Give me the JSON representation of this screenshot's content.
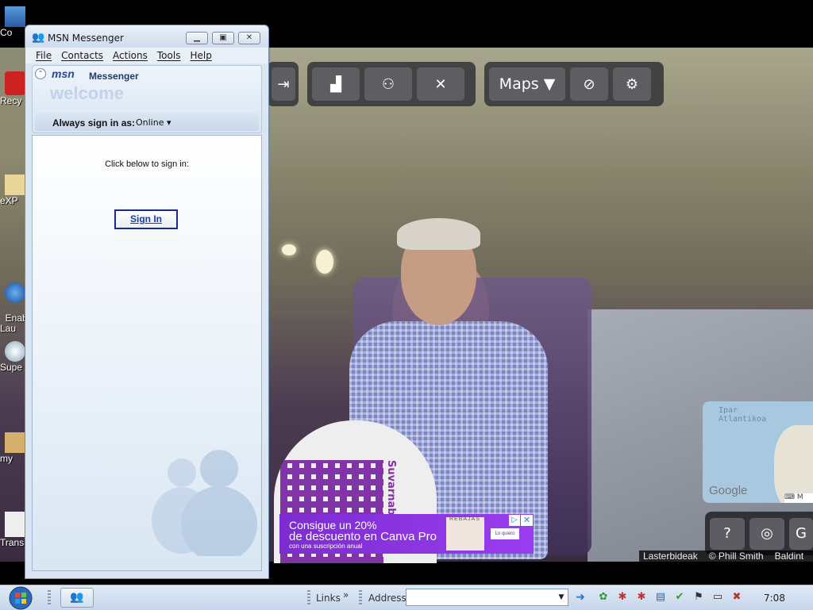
{
  "window": {
    "title": "MSN Messenger",
    "menu": [
      "File",
      "Contacts",
      "Actions",
      "Tools",
      "Help"
    ],
    "logo_text": "msn",
    "logo_word": "Messenger",
    "welcome": "welcome",
    "always_sign_in_label": "Always sign in as:",
    "status": "Online",
    "status_caret": "▾",
    "click_below": "Click below to sign in:",
    "sign_in_button": "Sign In"
  },
  "desktop_icons": [
    "Co",
    "Recy",
    "eXP",
    "Enab\nLau",
    "Supe",
    "my",
    "Trans"
  ],
  "streetview": {
    "maps_button": "Maps ▼",
    "map_ocean_label": "Ipar\nAtlantikoa",
    "google_logo": "Google",
    "help_button": "?",
    "credits": [
      "Lasterbideak",
      "© Phill Smith",
      "Baldint"
    ],
    "qr_text": "Suvarnab"
  },
  "ad": {
    "line1": "Consigue un 20%",
    "line2": "de descuento en Canva Pro",
    "line3": "con una suscripción anual",
    "brand": "REBAJAS",
    "cta": "Lo quiero"
  },
  "taskbar": {
    "links_label": "Links",
    "links_chevron": "»",
    "address_label": "Address",
    "address_value": "",
    "clock": "7:08"
  },
  "colors": {
    "msn_frame": "#dbe6f3",
    "ad_purple": "#8a34e6",
    "taskbar": "#d3e0ef"
  }
}
